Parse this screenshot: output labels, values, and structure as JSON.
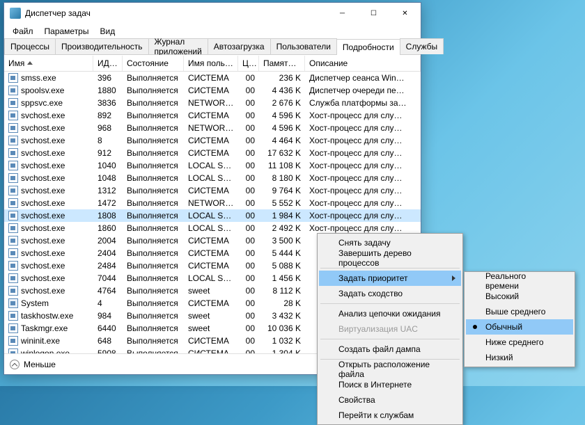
{
  "window": {
    "title": "Диспетчер задач"
  },
  "menubar": [
    "Файл",
    "Параметры",
    "Вид"
  ],
  "tabs": [
    "Процессы",
    "Производительность",
    "Журнал приложений",
    "Автозагрузка",
    "Пользователи",
    "Подробности",
    "Службы"
  ],
  "active_tab": 5,
  "columns": [
    "Имя",
    "ИД п...",
    "Состояние",
    "Имя польз...",
    "ЦП",
    "Память (ч...",
    "Описание"
  ],
  "rows": [
    {
      "name": "smss.exe",
      "pid": "396",
      "state": "Выполняется",
      "user": "СИСТЕМА",
      "cpu": "00",
      "mem": "236 K",
      "desc": "Диспетчер сеанса Win…"
    },
    {
      "name": "spoolsv.exe",
      "pid": "1880",
      "state": "Выполняется",
      "user": "СИСТЕМА",
      "cpu": "00",
      "mem": "4 436 K",
      "desc": "Диспетчер очереди пе…"
    },
    {
      "name": "sppsvc.exe",
      "pid": "3836",
      "state": "Выполняется",
      "user": "NETWORK…",
      "cpu": "00",
      "mem": "2 676 K",
      "desc": "Служба платформы за…"
    },
    {
      "name": "svchost.exe",
      "pid": "892",
      "state": "Выполняется",
      "user": "СИСТЕМА",
      "cpu": "00",
      "mem": "4 596 K",
      "desc": "Хост-процесс для слу…"
    },
    {
      "name": "svchost.exe",
      "pid": "968",
      "state": "Выполняется",
      "user": "NETWORK…",
      "cpu": "00",
      "mem": "4 596 K",
      "desc": "Хост-процесс для слу…"
    },
    {
      "name": "svchost.exe",
      "pid": "8",
      "state": "Выполняется",
      "user": "СИСТЕМА",
      "cpu": "00",
      "mem": "4 464 K",
      "desc": "Хост-процесс для слу…"
    },
    {
      "name": "svchost.exe",
      "pid": "912",
      "state": "Выполняется",
      "user": "СИСТЕМА",
      "cpu": "00",
      "mem": "17 632 K",
      "desc": "Хост-процесс для слу…"
    },
    {
      "name": "svchost.exe",
      "pid": "1040",
      "state": "Выполняется",
      "user": "LOCAL SE…",
      "cpu": "00",
      "mem": "11 108 K",
      "desc": "Хост-процесс для слу…"
    },
    {
      "name": "svchost.exe",
      "pid": "1048",
      "state": "Выполняется",
      "user": "LOCAL SE…",
      "cpu": "00",
      "mem": "8 180 K",
      "desc": "Хост-процесс для слу…"
    },
    {
      "name": "svchost.exe",
      "pid": "1312",
      "state": "Выполняется",
      "user": "СИСТЕМА",
      "cpu": "00",
      "mem": "9 764 K",
      "desc": "Хост-процесс для слу…"
    },
    {
      "name": "svchost.exe",
      "pid": "1472",
      "state": "Выполняется",
      "user": "NETWORK…",
      "cpu": "00",
      "mem": "5 552 K",
      "desc": "Хост-процесс для слу…"
    },
    {
      "name": "svchost.exe",
      "pid": "1808",
      "state": "Выполняется",
      "user": "LOCAL SE…",
      "cpu": "00",
      "mem": "1 984 K",
      "desc": "Хост-процесс для слу…",
      "selected": true
    },
    {
      "name": "svchost.exe",
      "pid": "1860",
      "state": "Выполняется",
      "user": "LOCAL SE…",
      "cpu": "00",
      "mem": "2 492 K",
      "desc": "Хост-процесс для слу…"
    },
    {
      "name": "svchost.exe",
      "pid": "2004",
      "state": "Выполняется",
      "user": "СИСТЕМА",
      "cpu": "00",
      "mem": "3 500 K",
      "desc": ""
    },
    {
      "name": "svchost.exe",
      "pid": "2404",
      "state": "Выполняется",
      "user": "СИСТЕМА",
      "cpu": "00",
      "mem": "5 444 K",
      "desc": ""
    },
    {
      "name": "svchost.exe",
      "pid": "2484",
      "state": "Выполняется",
      "user": "СИСТЕМА",
      "cpu": "00",
      "mem": "5 088 K",
      "desc": ""
    },
    {
      "name": "svchost.exe",
      "pid": "7044",
      "state": "Выполняется",
      "user": "LOCAL SE…",
      "cpu": "00",
      "mem": "1 456 K",
      "desc": ""
    },
    {
      "name": "svchost.exe",
      "pid": "4764",
      "state": "Выполняется",
      "user": "sweet",
      "cpu": "00",
      "mem": "8 112 K",
      "desc": ""
    },
    {
      "name": "System",
      "pid": "4",
      "state": "Выполняется",
      "user": "СИСТЕМА",
      "cpu": "00",
      "mem": "28 K",
      "desc": ""
    },
    {
      "name": "taskhostw.exe",
      "pid": "984",
      "state": "Выполняется",
      "user": "sweet",
      "cpu": "00",
      "mem": "3 432 K",
      "desc": ""
    },
    {
      "name": "Taskmgr.exe",
      "pid": "6440",
      "state": "Выполняется",
      "user": "sweet",
      "cpu": "00",
      "mem": "10 036 K",
      "desc": ""
    },
    {
      "name": "wininit.exe",
      "pid": "648",
      "state": "Выполняется",
      "user": "СИСТЕМА",
      "cpu": "00",
      "mem": "1 032 K",
      "desc": ""
    },
    {
      "name": "winlogon.exe",
      "pid": "5908",
      "state": "Выполняется",
      "user": "СИСТЕМА",
      "cpu": "00",
      "mem": "1 304 K",
      "desc": ""
    }
  ],
  "footer_label": "Меньше",
  "context_menu": {
    "items": [
      {
        "label": "Снять задачу"
      },
      {
        "label": "Завершить дерево процессов"
      },
      {
        "sep": true
      },
      {
        "label": "Задать приоритет",
        "submenu": true,
        "hover": true
      },
      {
        "label": "Задать сходство"
      },
      {
        "sep": true
      },
      {
        "label": "Анализ цепочки ожидания"
      },
      {
        "label": "Виртуализация UAC",
        "disabled": true
      },
      {
        "sep": true
      },
      {
        "label": "Создать файл дампа"
      },
      {
        "sep": true
      },
      {
        "label": "Открыть расположение файла"
      },
      {
        "label": "Поиск в Интернете"
      },
      {
        "label": "Свойства"
      },
      {
        "label": "Перейти к службам"
      }
    ]
  },
  "priority_submenu": {
    "items": [
      {
        "label": "Реального времени"
      },
      {
        "label": "Высокий"
      },
      {
        "label": "Выше среднего"
      },
      {
        "label": "Обычный",
        "checked": true,
        "hover": true
      },
      {
        "label": "Ниже среднего"
      },
      {
        "label": "Низкий"
      }
    ]
  }
}
